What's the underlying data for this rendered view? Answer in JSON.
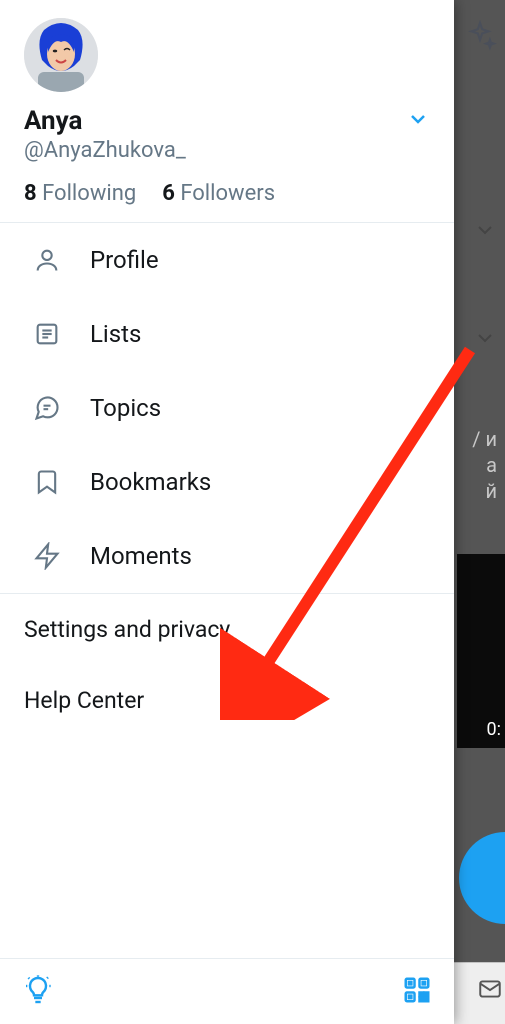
{
  "profile": {
    "display_name": "Anya",
    "handle": "@AnyaZhukova_",
    "following_count": "8",
    "following_label": "Following",
    "followers_count": "6",
    "followers_label": "Followers"
  },
  "menu": {
    "profile": "Profile",
    "lists": "Lists",
    "topics": "Topics",
    "bookmarks": "Bookmarks",
    "moments": "Moments"
  },
  "secondary": {
    "settings": "Settings and privacy",
    "help": "Help Center"
  },
  "background": {
    "text1": "/ и",
    "text2": "а",
    "text3": "й",
    "duration": "0:"
  }
}
